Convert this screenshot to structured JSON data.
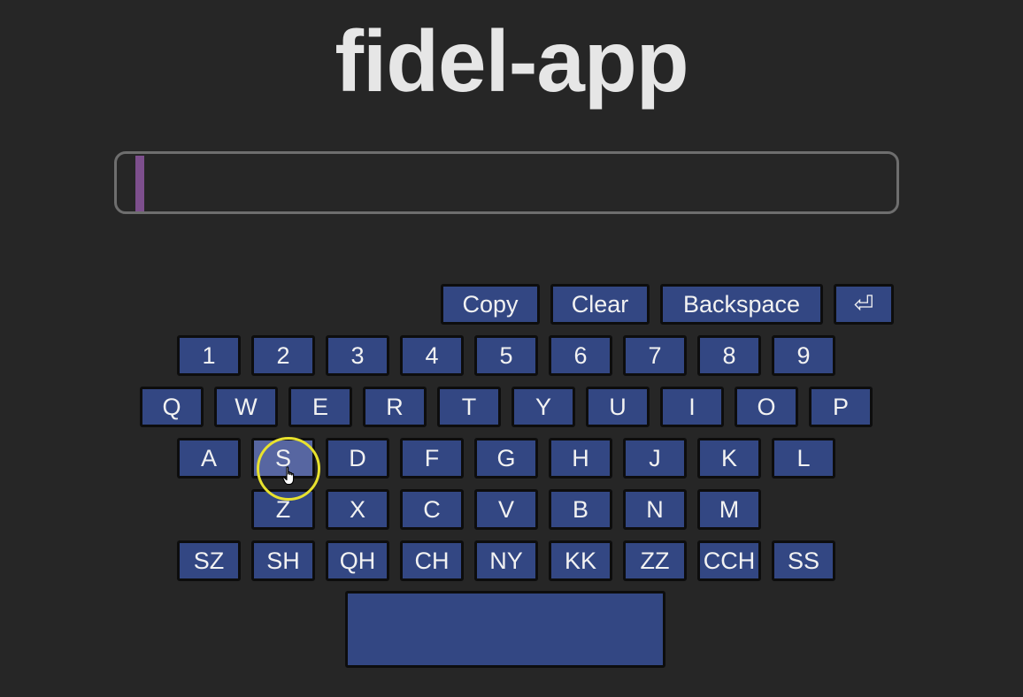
{
  "app": {
    "title": "fidel-app"
  },
  "text_input": {
    "value": ""
  },
  "actions": {
    "copy_label": "Copy",
    "clear_label": "Clear",
    "backspace_label": "Backspace",
    "enter_label": "⏎"
  },
  "keyboard": {
    "row_numbers": [
      "1",
      "2",
      "3",
      "4",
      "5",
      "6",
      "7",
      "8",
      "9"
    ],
    "row_qwerty": [
      "Q",
      "W",
      "E",
      "R",
      "T",
      "Y",
      "U",
      "I",
      "O",
      "P"
    ],
    "row_home": [
      "A",
      "S",
      "D",
      "F",
      "G",
      "H",
      "J",
      "K",
      "L"
    ],
    "row_bottom": [
      "Z",
      "X",
      "C",
      "V",
      "B",
      "N",
      "M"
    ],
    "row_digraphs": [
      "SZ",
      "SH",
      "QH",
      "CH",
      "NY",
      "KK",
      "ZZ",
      "CCH",
      "SS"
    ],
    "space_label": "",
    "hovered_key": "S"
  },
  "colors": {
    "background": "#262626",
    "key_fill": "#334783",
    "key_hover": "#5766a1",
    "caret": "#7d4f8d",
    "cursor_ring": "#e8e22e"
  },
  "icons": {
    "enter": "return-icon",
    "pointer": "hand-pointer-icon"
  }
}
